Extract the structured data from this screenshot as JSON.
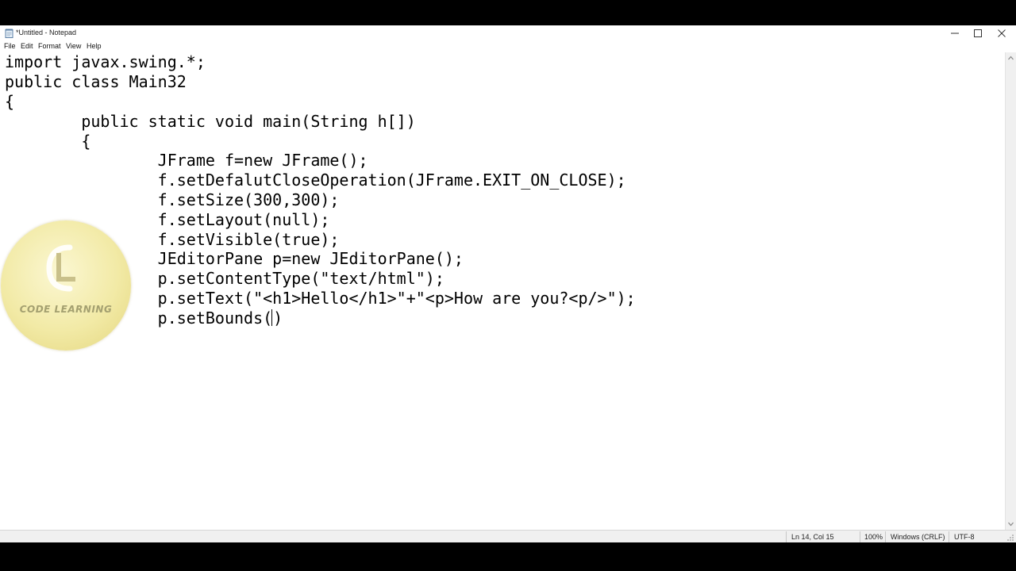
{
  "window": {
    "title": "*Untitled - Notepad"
  },
  "icons": {
    "app": "notepad-icon",
    "minimize": "minimize-icon",
    "maximize": "maximize-icon",
    "close": "close-icon"
  },
  "menu": [
    "File",
    "Edit",
    "Format",
    "View",
    "Help"
  ],
  "editor": {
    "lines": [
      "import javax.swing.*;",
      "public class Main32",
      "{",
      "        public static void main(String h[])",
      "        {",
      "                JFrame f=new JFrame();",
      "                f.setDefalutCloseOperation(JFrame.EXIT_ON_CLOSE);",
      "                f.setSize(300,300);",
      "                f.setLayout(null);",
      "                f.setVisible(true);",
      "                JEditorPane p=new JEditorPane();",
      "                p.setContentType(\"text/html\");",
      "                p.setText(\"<h1>Hello</h1>\"+\"<p>How are you?<p/>\");"
    ],
    "caret_line": {
      "before": "                p.setBounds(",
      "after": ")"
    }
  },
  "status": {
    "position": "Ln 14, Col 15",
    "zoom": "100%",
    "line_ending": "Windows (CRLF)",
    "encoding": "UTF-8"
  },
  "logo": {
    "text": "CODE LEARNING"
  },
  "colors": {
    "logo_fill": "#f2eaa6",
    "logo_text": "#a4a070"
  }
}
